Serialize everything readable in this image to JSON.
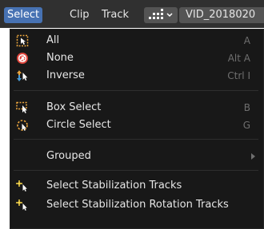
{
  "header": {
    "menus": [
      {
        "label": "Select"
      },
      {
        "label": "Clip"
      },
      {
        "label": "Track"
      }
    ],
    "editor_type_icon": "clip-editor-icon",
    "clip_name": "VID_2018020"
  },
  "menu": {
    "items": [
      {
        "label": "All",
        "shortcut": "A",
        "icon": "select-all-icon"
      },
      {
        "label": "None",
        "shortcut": "Alt A",
        "icon": "select-none-icon"
      },
      {
        "label": "Inverse",
        "shortcut": "Ctrl I",
        "icon": "select-inverse-icon"
      },
      {
        "label": "Box Select",
        "shortcut": "B",
        "icon": "box-select-icon"
      },
      {
        "label": "Circle Select",
        "shortcut": "G",
        "icon": "circle-select-icon"
      },
      {
        "label": "Grouped",
        "submenu": true
      },
      {
        "label": "Select Stabilization Tracks",
        "icon": "stabilization-track-icon"
      },
      {
        "label": "Select Stabilization Rotation Tracks",
        "icon": "stabilization-track-icon"
      }
    ]
  },
  "colors": {
    "accent": "#4772b3",
    "icon_orange": "#e8a33d",
    "icon_red": "#e0453c",
    "icon_yellow": "#f2d24a",
    "menu_bg": "#181818"
  }
}
